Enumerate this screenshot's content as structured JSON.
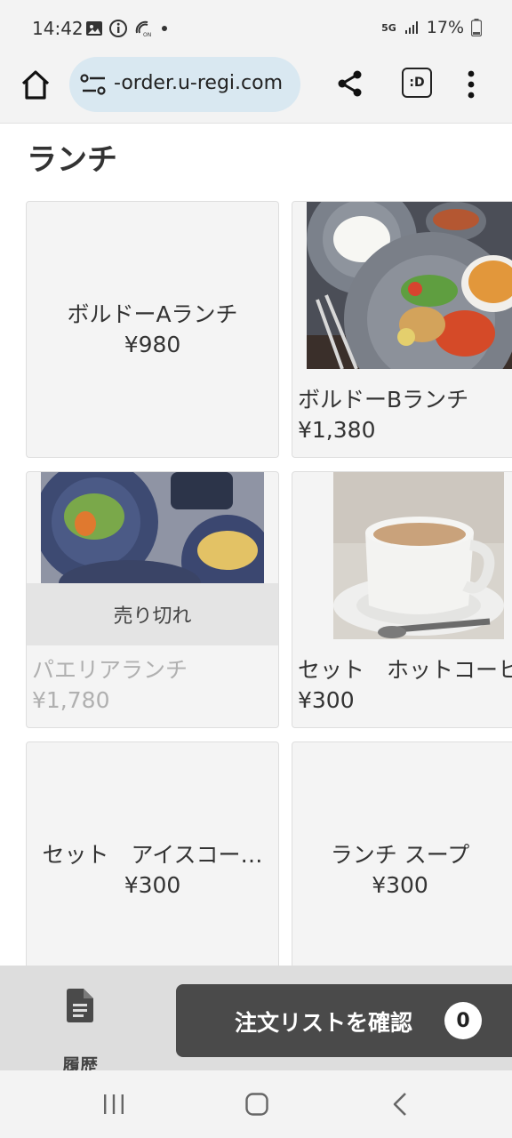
{
  "status": {
    "time": "14:42",
    "network": "5G",
    "battery": "17%"
  },
  "browser": {
    "url": "-order.u-regi.com",
    "dex_label": ":D"
  },
  "section": {
    "title": "ランチ"
  },
  "products": [
    {
      "name": "ボルドーAランチ",
      "price": "¥980"
    },
    {
      "name": "ボルドーBランチ",
      "price": "¥1,380"
    },
    {
      "name": "パエリアランチ",
      "price": "¥1,780",
      "badge": "売り切れ"
    },
    {
      "name": "セット　ホットコーヒー",
      "price": "¥300"
    },
    {
      "name": "セット　アイスコー…",
      "price": "¥300"
    },
    {
      "name": "ランチ スープ",
      "price": "¥300"
    }
  ],
  "footer": {
    "history_label": "履歴",
    "order_label": "注文リストを確認",
    "order_count": "0"
  },
  "icons": [
    "home-icon",
    "site-settings-icon",
    "share-icon",
    "dex-icon",
    "more-vert-icon",
    "document-icon",
    "recents-icon",
    "home-nav-icon",
    "back-icon"
  ]
}
